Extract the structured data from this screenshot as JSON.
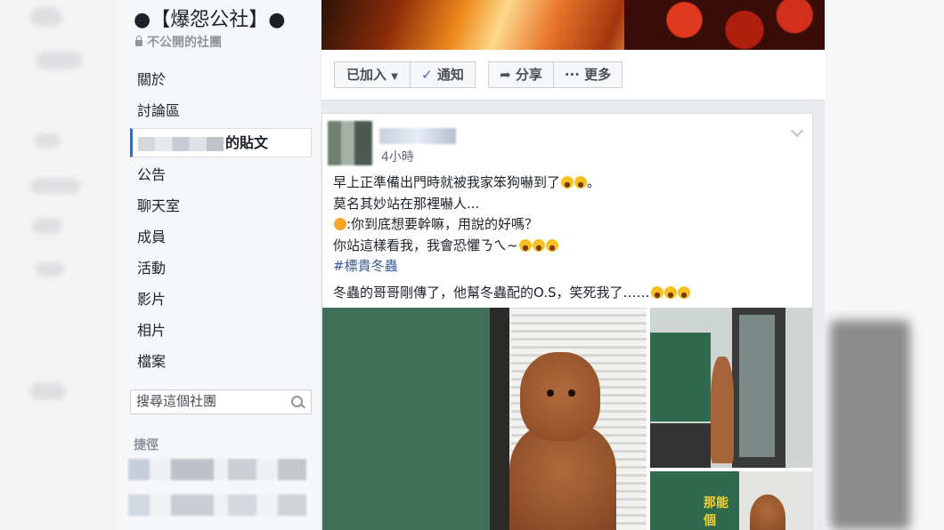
{
  "group": {
    "title": "●【爆怨公社】●",
    "privacy": "不公開的社團"
  },
  "nav": {
    "items": [
      {
        "label": "關於"
      },
      {
        "label": "討論區"
      },
      {
        "label": "的貼文"
      },
      {
        "label": "公告"
      },
      {
        "label": "聊天室"
      },
      {
        "label": "成員"
      },
      {
        "label": "活動"
      },
      {
        "label": "影片"
      },
      {
        "label": "相片"
      },
      {
        "label": "檔案"
      }
    ]
  },
  "search": {
    "placeholder": "搜尋這個社團"
  },
  "shortcuts": {
    "label": "捷徑"
  },
  "actions": {
    "joined": "已加入",
    "notify": "通知",
    "share": "分享",
    "more": "更多"
  },
  "post": {
    "time": "4小時",
    "line1": "早上正準備出門時就被我家笨狗嚇到了",
    "line1_end": "。",
    "line2": "莫名其妙站在那裡嚇人...",
    "line3": ":你到底想要幹嘛，用說的好嗎？",
    "line4": "你站這樣看我，我會恐懼ㄋㄟ~",
    "hashtag": "#標貴冬蟲",
    "line5": "冬蟲的哥哥剛傳了，他幫冬蟲配的O.S，笑死我了……"
  },
  "photo_text": "那能個"
}
